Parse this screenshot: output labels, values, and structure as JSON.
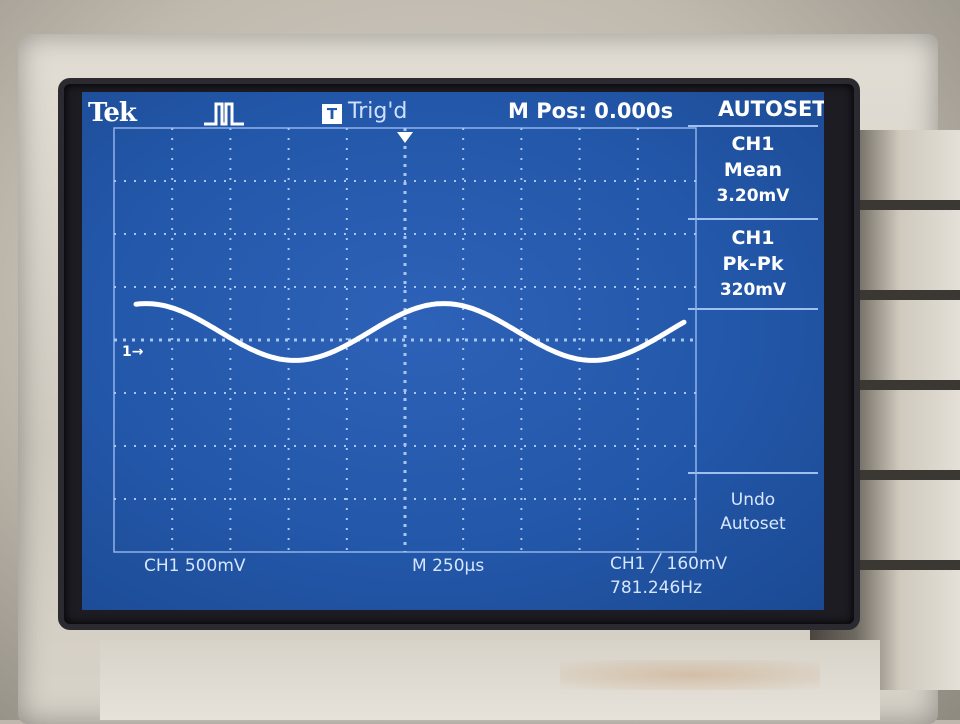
{
  "header": {
    "brand": "Tek",
    "acquisition_icon": "pulse-run-icon",
    "trigger_badge": "T",
    "trigger_status": "Trig'd",
    "main_position": "M Pos: 0.000s",
    "menu_title": "AUTOSET"
  },
  "side_menu": {
    "measure1": {
      "channel": "CH1",
      "type": "Mean",
      "value": "3.20mV"
    },
    "measure2": {
      "channel": "CH1",
      "type": "Pk-Pk",
      "value": "320mV"
    },
    "undo": {
      "line1": "Undo",
      "line2": "Autoset"
    }
  },
  "graticule": {
    "ch1_marker": "1→",
    "trigger_marker_icon": "trigger-position-arrow-icon"
  },
  "footer": {
    "ch1_scale": "CH1  500mV",
    "timebase": "M 250µs",
    "trigger_info": "CH1 ╱ 160mV",
    "frequency": "781.246Hz"
  },
  "waveform": {
    "channel": "CH1",
    "shape": "sine",
    "frequency_hz": 781.246,
    "peak_to_peak_mV": 320,
    "mean_mV": 3.2,
    "volts_per_div_mV": 500,
    "time_per_div_us": 250,
    "trace_color": "#ffffff"
  },
  "colors": {
    "screen_bg": "#2357a9",
    "grid_dots": "#a9c6f2",
    "text": "#ffffff"
  }
}
